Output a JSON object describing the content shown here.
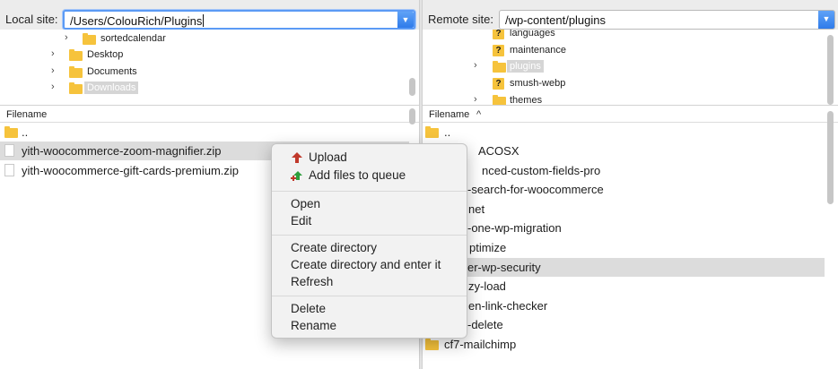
{
  "local": {
    "site_label": "Local site:",
    "site_value": "/Users/ColouRich/Plugins",
    "tree": [
      {
        "label": "sortedcalendar",
        "selected": false
      },
      {
        "label": "Desktop",
        "selected": false
      },
      {
        "label": "Documents",
        "selected": false
      },
      {
        "label": "Downloads",
        "selected": true
      }
    ],
    "header": "Filename",
    "files": [
      {
        "name": "..",
        "type": "folder"
      },
      {
        "name": "yith-woocommerce-zoom-magnifier.zip",
        "type": "file"
      },
      {
        "name": "yith-woocommerce-gift-cards-premium.zip",
        "type": "file"
      }
    ]
  },
  "remote": {
    "site_label": "Remote site:",
    "site_value": "/wp-content/plugins",
    "tree": [
      {
        "label": "languages",
        "icon": "question-folder-icon"
      },
      {
        "label": "maintenance",
        "icon": "question-folder-icon"
      },
      {
        "label": "plugins",
        "icon": "folder-icon",
        "selected": true
      },
      {
        "label": "smush-webp",
        "icon": "question-folder-icon"
      },
      {
        "label": "themes",
        "icon": "folder-icon"
      }
    ],
    "header": "Filename",
    "sort_icon": "chevron-up-icon",
    "files": [
      {
        "name": "..",
        "highlight": false
      },
      {
        "name": "ACOSX",
        "highlight": false
      },
      {
        "name": "nced-custom-fields-pro",
        "highlight": false
      },
      {
        "name": "-search-for-woocommerce",
        "highlight": false
      },
      {
        "name": "net",
        "highlight": false
      },
      {
        "name": "-one-wp-migration",
        "highlight": false
      },
      {
        "name": "ptimize",
        "highlight": false
      },
      {
        "name": "er-wp-security",
        "highlight": true
      },
      {
        "name": "zy-load",
        "highlight": false
      },
      {
        "name": "en-link-checker",
        "highlight": false
      },
      {
        "name": "-delete",
        "highlight": false
      },
      {
        "name": "cf7-mailchimp",
        "highlight": false
      }
    ]
  },
  "context_menu": {
    "upload": "Upload",
    "add_queue": "Add files to queue",
    "open": "Open",
    "edit": "Edit",
    "create_dir": "Create directory",
    "create_dir_enter": "Create directory and enter it",
    "refresh": "Refresh",
    "delete": "Delete",
    "rename": "Rename"
  },
  "colors": {
    "accent": "#2f7bea",
    "folder": "#f6c33c",
    "upload_arrow": "#c0392b",
    "queue_arrow": "#2e9e3c"
  }
}
